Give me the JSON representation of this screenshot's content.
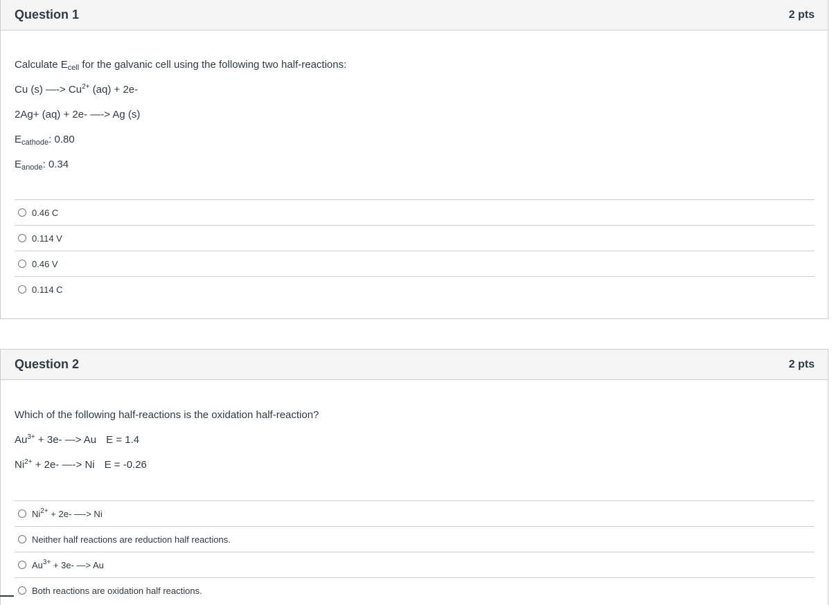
{
  "question1": {
    "title": "Question 1",
    "points": "2 pts",
    "prompt_start": "Calculate E",
    "prompt_sub": "cell",
    "prompt_end": " for the galvanic cell using the following two half-reactions:",
    "reaction1_start": "Cu (s) —-> Cu",
    "reaction1_sup": "2+",
    "reaction1_end": " (aq) + 2e-",
    "reaction2": "2Ag+ (aq) + 2e- —-> Ag (s)",
    "cathode_label": "E",
    "cathode_sub": "cathode",
    "cathode_value": ": 0.80",
    "anode_label": "E",
    "anode_sub": "anode",
    "anode_value": ": 0.34",
    "answers": [
      "0.46 C",
      "0.114 V",
      "0.46 V",
      "0.114 C"
    ]
  },
  "question2": {
    "title": "Question 2",
    "points": "2 pts",
    "prompt": "Which of the following half-reactions is the oxidation half-reaction?",
    "reaction1_start": "Au",
    "reaction1_sup": "3+",
    "reaction1_mid": " + 3e- —> Au",
    "reaction1_e": "E = 1.4",
    "reaction2_start": "Ni",
    "reaction2_sup": "2+",
    "reaction2_mid": " + 2e- —-> Ni",
    "reaction2_e": "E = -0.26",
    "answer1_start": "Ni",
    "answer1_sup": "2+",
    "answer1_end": " + 2e- —-> Ni",
    "answer2": "Neither half reactions are reduction half reactions.",
    "answer3_start": "Au",
    "answer3_sup": "3+",
    "answer3_end": " + 3e- —> Au",
    "answer4": "Both reactions are oxidation half reactions."
  }
}
